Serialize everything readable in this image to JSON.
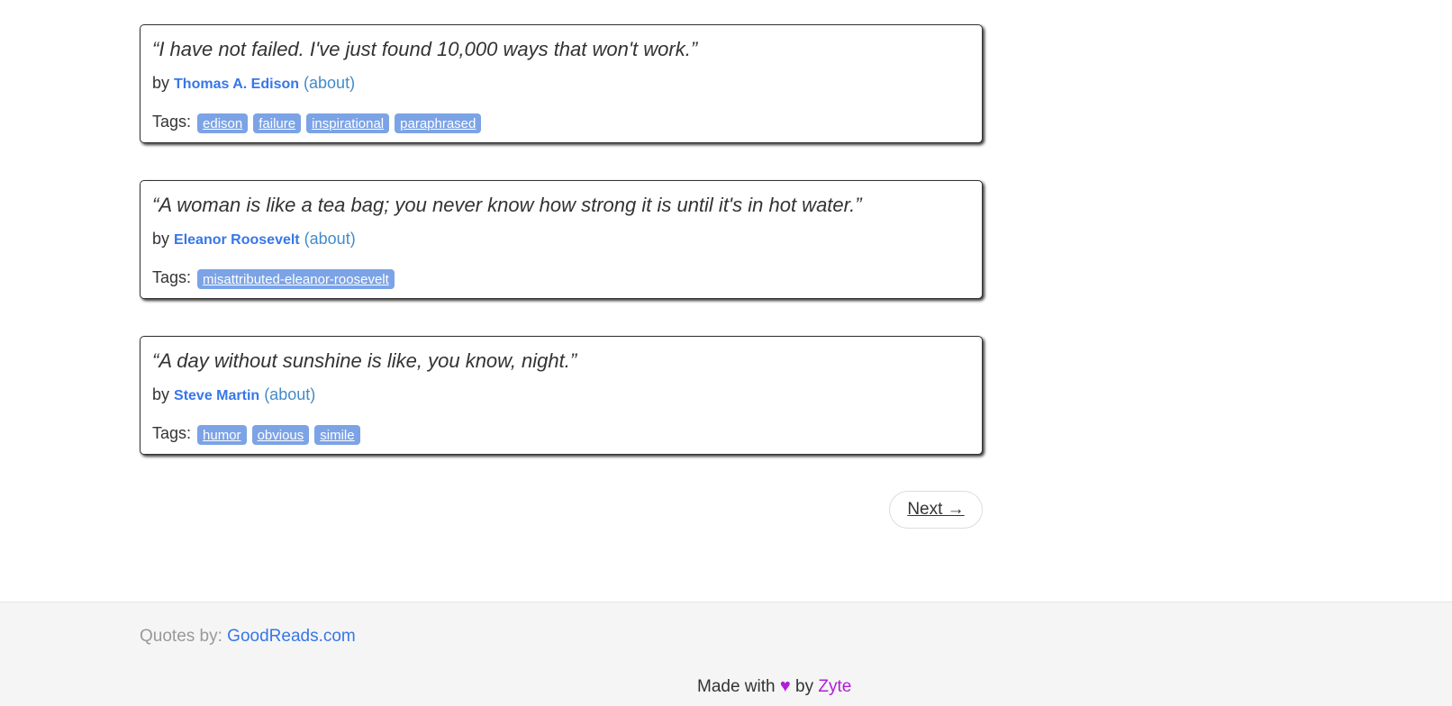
{
  "quotes": [
    {
      "text": "“I have not failed. I've just found 10,000 ways that won't work.”",
      "by": "by",
      "author": "Thomas A. Edison",
      "about": "(about)",
      "tags_label": "Tags:",
      "tags": [
        "edison",
        "failure",
        "inspirational",
        "paraphrased"
      ]
    },
    {
      "text": "“A woman is like a tea bag; you never know how strong it is until it's in hot water.”",
      "by": "by",
      "author": "Eleanor Roosevelt",
      "about": "(about)",
      "tags_label": "Tags:",
      "tags": [
        "misattributed-eleanor-roosevelt"
      ]
    },
    {
      "text": "“A day without sunshine is like, you know, night.”",
      "by": "by",
      "author": "Steve Martin",
      "about": "(about)",
      "tags_label": "Tags:",
      "tags": [
        "humor",
        "obvious",
        "simile"
      ]
    }
  ],
  "pager": {
    "next_label": "Next →"
  },
  "footer": {
    "quotes_by_label": "Quotes by:",
    "goodreads_link": "GoodReads.com",
    "made_with": "Made with",
    "heart": "♥",
    "by": "by",
    "zyte_link": "Zyte"
  },
  "colors": {
    "accent": "#3677e8",
    "tag_bg": "#7ca3e5",
    "heart": "#b01ed5",
    "footer_bg": "#f5f5f5"
  }
}
